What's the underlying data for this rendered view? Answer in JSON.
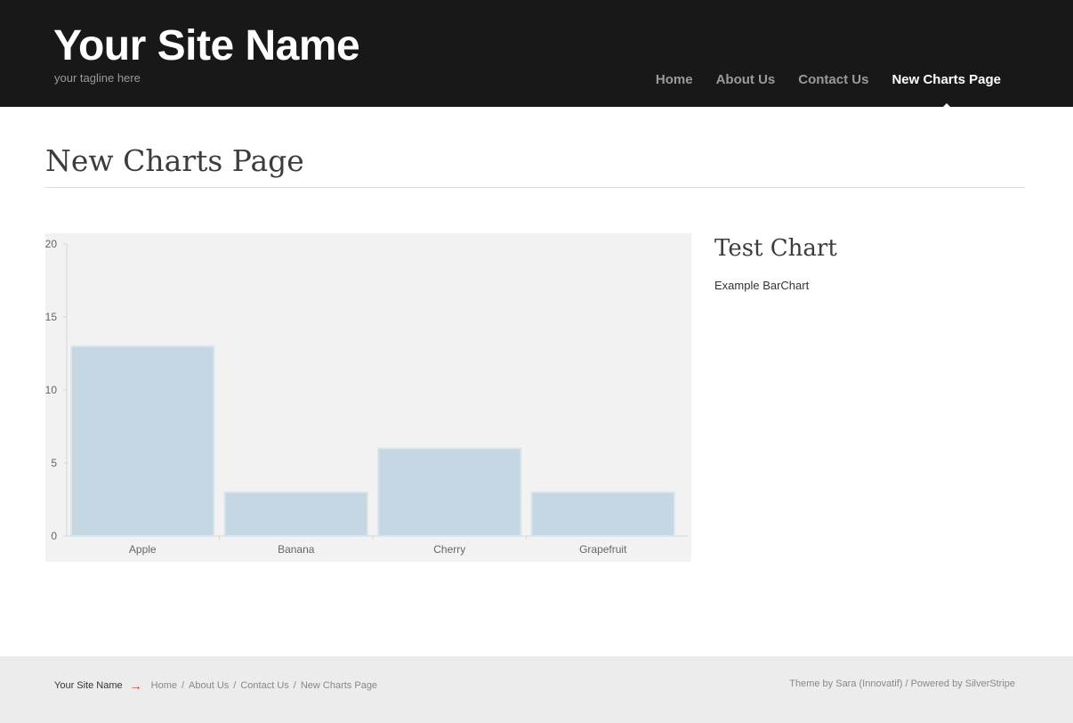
{
  "header": {
    "site_name": "Your Site Name",
    "tagline": "your tagline here",
    "nav": [
      {
        "label": "Home",
        "active": false
      },
      {
        "label": "About Us",
        "active": false
      },
      {
        "label": "Contact Us",
        "active": false
      },
      {
        "label": "New Charts Page",
        "active": true
      }
    ]
  },
  "page": {
    "title": "New Charts Page"
  },
  "sidebar": {
    "title": "Test Chart",
    "text": "Example BarChart"
  },
  "chart_data": {
    "type": "bar",
    "categories": [
      "Apple",
      "Banana",
      "Cherry",
      "Grapefruit"
    ],
    "values": [
      13,
      3,
      6,
      3
    ],
    "ylim": [
      0,
      20
    ],
    "yticks": [
      0,
      5,
      10,
      15,
      20
    ],
    "title": "",
    "xlabel": "",
    "ylabel": "",
    "grid": false,
    "colors": {
      "bar": "#c5d7e2",
      "bar_edge": "#dbe6ec",
      "background": "#f2f2f2",
      "axis": "#d6d6d6"
    }
  },
  "footer": {
    "site_name": "Your Site Name",
    "arrow": "→",
    "breadcrumbs": [
      "Home",
      "About Us",
      "Contact Us",
      "New Charts Page"
    ],
    "separator": "/",
    "credits": "Theme by Sara (Innovatif) / Powered by SilverStripe"
  }
}
